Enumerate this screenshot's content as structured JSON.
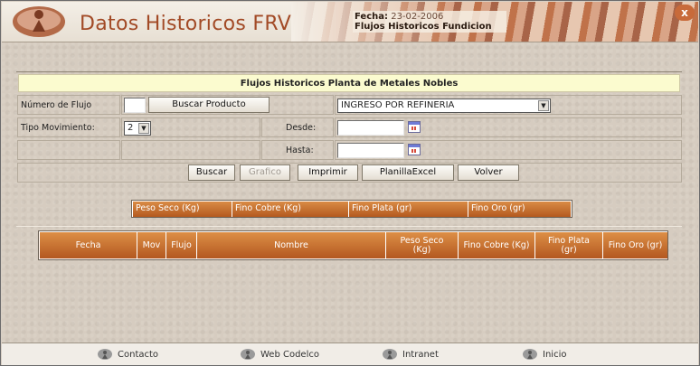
{
  "header": {
    "site_title": "Datos Historicos FRV",
    "fecha_label": "Fecha:",
    "fecha_value": "23-02-2006",
    "subtitle": "Flujos Historicos Fundicion",
    "close_glyph": "x"
  },
  "form": {
    "title": "Flujos Historicos Planta de Metales Nobles",
    "numero_flujo_label": "Número de Flujo",
    "numero_flujo_value": "",
    "buscar_producto_label": "Buscar Producto",
    "producto_selected": "INGRESO POR REFINERIA",
    "tipo_movimiento_label": "Tipo Movimiento:",
    "tipo_movimiento_value": "2",
    "desde_label": "Desde:",
    "desde_value": "",
    "hasta_label": "Hasta:",
    "hasta_value": ""
  },
  "buttons": {
    "buscar": "Buscar",
    "grafico": "Grafico",
    "imprimir": "Imprimir",
    "planilla": "PlanillaExcel",
    "volver": "Volver"
  },
  "summary_table": {
    "headers": [
      "Peso Seco (Kg)",
      "Fino Cobre (Kg)",
      "Fino Plata (gr)",
      "Fino Oro (gr)"
    ]
  },
  "detail_table": {
    "headers": [
      "Fecha",
      "Mov",
      "Flujo",
      "Nombre",
      "Peso Seco (Kg)",
      "Fino Cobre (Kg)",
      "Fino Plata (gr)",
      "Fino Oro (gr)"
    ]
  },
  "footer": {
    "links": [
      "Contacto",
      "Web Codelco",
      "Intranet",
      "Inicio"
    ]
  },
  "colors": {
    "accent": "#b45a1f",
    "title_bg": "#fbfbcf",
    "brand_text": "#a24a26"
  },
  "icons": {
    "logo": "person-sphere-logo",
    "calendar": "calendar-icon",
    "footer": "globe-person-icon"
  }
}
